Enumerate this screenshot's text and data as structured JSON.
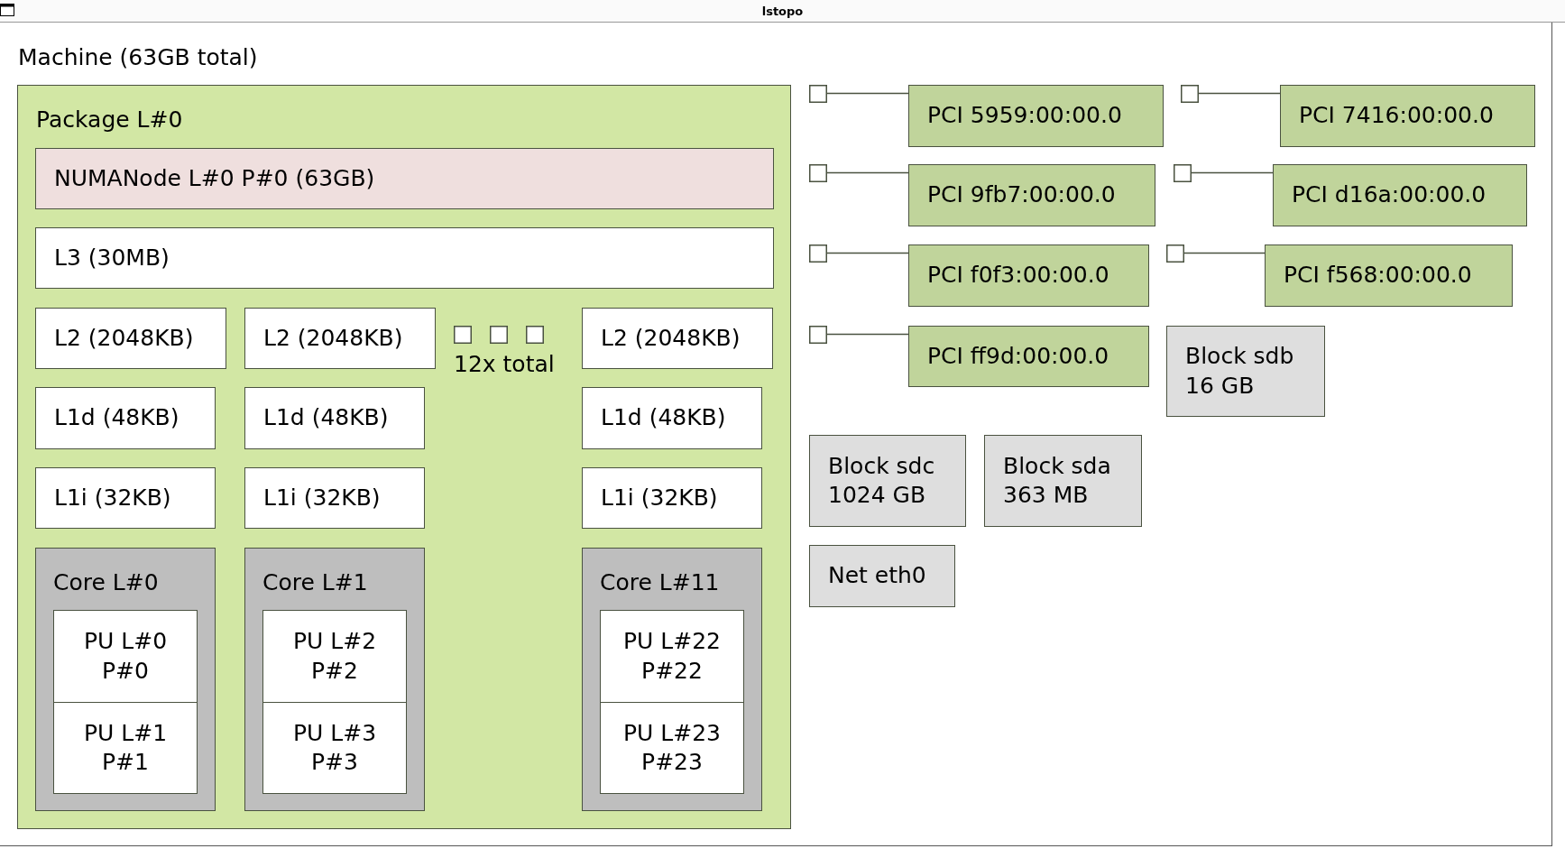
{
  "window": {
    "title": "lstopo"
  },
  "machine": {
    "label": "Machine (63GB total)",
    "package": {
      "label": "Package L#0",
      "numa": "NUMANode L#0 P#0 (63GB)",
      "l3": "L3 (30MB)",
      "collapsed": "12x total",
      "columns": [
        {
          "l2": "L2 (2048KB)",
          "l1d": "L1d (48KB)",
          "l1i": "L1i (32KB)",
          "core": "Core L#0",
          "pus": [
            "PU L#0\nP#0",
            "PU L#1\nP#1"
          ]
        },
        {
          "l2": "L2 (2048KB)",
          "l1d": "L1d (48KB)",
          "l1i": "L1i (32KB)",
          "core": "Core L#1",
          "pus": [
            "PU L#2\nP#2",
            "PU L#3\nP#3"
          ]
        },
        {
          "l2": "L2 (2048KB)",
          "l1d": "L1d (48KB)",
          "l1i": "L1i (32KB)",
          "core": "Core L#11",
          "pus": [
            "PU L#22\nP#22",
            "PU L#23\nP#23"
          ]
        }
      ]
    },
    "io": [
      {
        "kind": "pci",
        "label": "PCI 5959:00:00.0"
      },
      {
        "kind": "pci",
        "label": "PCI 7416:00:00.0"
      },
      {
        "kind": "pci",
        "label": "PCI 9fb7:00:00.0"
      },
      {
        "kind": "pci",
        "label": "PCI d16a:00:00.0"
      },
      {
        "kind": "pci",
        "label": "PCI f0f3:00:00.0"
      },
      {
        "kind": "pci",
        "label": "PCI f568:00:00.0"
      },
      {
        "kind": "pci",
        "label": "PCI ff9d:00:00.0"
      },
      {
        "kind": "block",
        "label": "Block sdb\n16 GB"
      },
      {
        "kind": "block",
        "label": "Block sdc\n1024 GB"
      },
      {
        "kind": "block",
        "label": "Block sda\n363 MB"
      },
      {
        "kind": "net",
        "label": "Net eth0"
      }
    ]
  }
}
